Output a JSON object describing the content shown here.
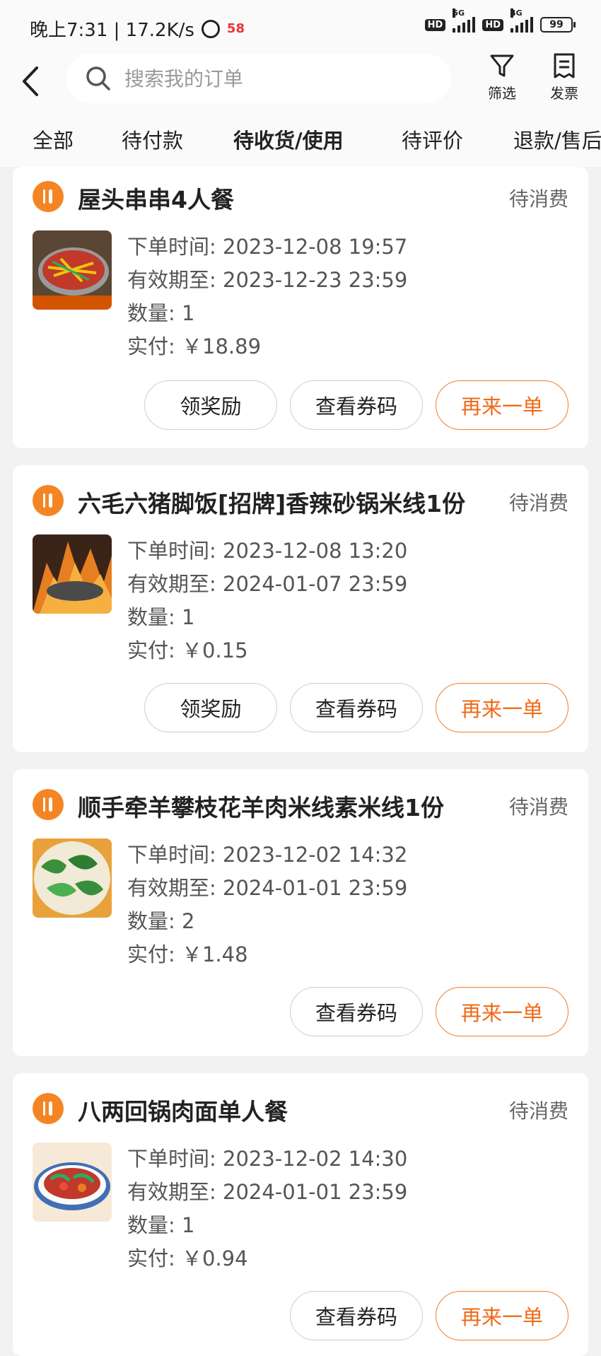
{
  "status_bar": {
    "left_text": "晚上7:31 | 17.2K/s",
    "app_badge": "58",
    "net1": "5G",
    "net2": "4G",
    "hd": "HD",
    "battery": "99"
  },
  "nav": {
    "search_placeholder": "搜索我的订单",
    "filter_label": "筛选",
    "invoice_label": "发票"
  },
  "tabs": [
    {
      "label": "全部",
      "active": false
    },
    {
      "label": "待付款",
      "active": false
    },
    {
      "label": "待收货/使用",
      "active": true
    },
    {
      "label": "待评价",
      "active": false
    },
    {
      "label": "退款/售后",
      "active": false
    }
  ],
  "labels": {
    "order_time": "下单时间: ",
    "valid_until": "有效期至: ",
    "quantity": "数量: ",
    "paid": "实付: "
  },
  "colors": {
    "accent": "#f58523",
    "tab_underline": "#ffd21f",
    "primary_button": "#f06a1a"
  },
  "orders": [
    {
      "title": "屋头串串4人餐",
      "status": "待消费",
      "order_time": "2023-12-08 19:57",
      "valid_until": "2023-12-23 23:59",
      "quantity": "1",
      "paid": "￥18.89",
      "buttons": [
        "领奖励",
        "查看券码",
        "再来一单"
      ]
    },
    {
      "title": "六毛六猪脚饭[招牌]香辣砂锅米线1份",
      "status": "待消费",
      "order_time": "2023-12-08 13:20",
      "valid_until": "2024-01-07 23:59",
      "quantity": "1",
      "paid": "￥0.15",
      "buttons": [
        "领奖励",
        "查看券码",
        "再来一单"
      ]
    },
    {
      "title": "顺手牵羊攀枝花羊肉米线素米线1份",
      "status": "待消费",
      "order_time": "2023-12-02 14:32",
      "valid_until": "2024-01-01 23:59",
      "quantity": "2",
      "paid": "￥1.48",
      "buttons": [
        "查看券码",
        "再来一单"
      ]
    },
    {
      "title": "八两回锅肉面单人餐",
      "status": "待消费",
      "order_time": "2023-12-02 14:30",
      "valid_until": "2024-01-01 23:59",
      "quantity": "1",
      "paid": "￥0.94",
      "buttons": [
        "查看券码",
        "再来一单"
      ]
    }
  ]
}
